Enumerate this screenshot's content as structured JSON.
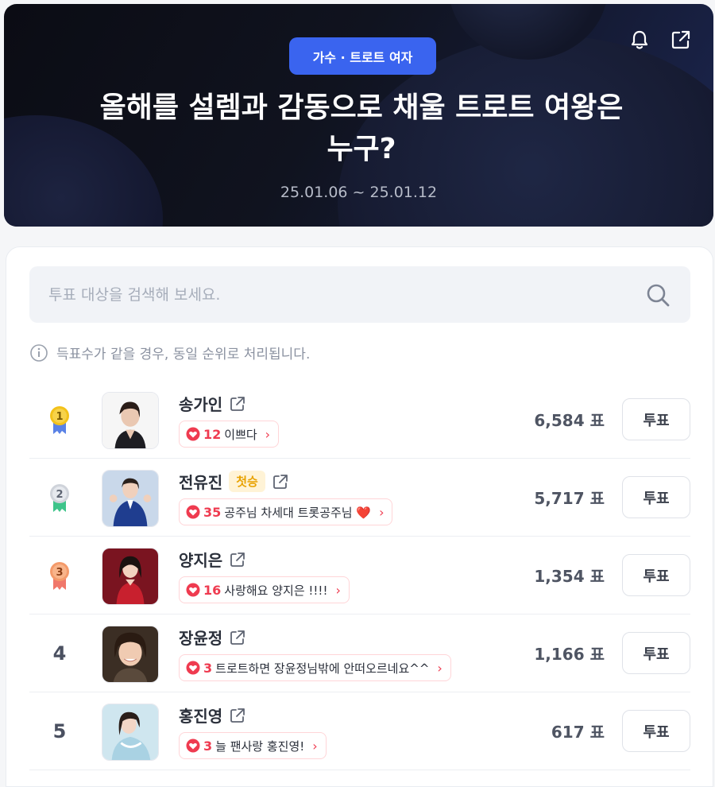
{
  "header": {
    "category": "가수 · 트로트 여자",
    "title_line1": "올해를 설렘과 감동으로 채울 트로트 여왕은",
    "title_line2": "누구?",
    "period": "25.01.06 ~ 25.01.12",
    "icons": [
      "bell-icon",
      "share-icon"
    ]
  },
  "search": {
    "placeholder": "투표 대상을 검색해 보세요.",
    "value": ""
  },
  "notice": "득표수가 같을 경우, 동일 순위로 처리됩니다.",
  "colors": {
    "accent": "#3a64ef",
    "heart": "#ef3b50",
    "gold": "#f3c21a",
    "silver": "#d5d8de",
    "bronze": "#f49a6a"
  },
  "candidates": [
    {
      "rank": "1",
      "medal": "gold",
      "name": "송가인",
      "badge": "",
      "cheer_count": "12",
      "cheer_text": "이쁘다",
      "votes": "6,584 표",
      "vote_label": "투표"
    },
    {
      "rank": "2",
      "medal": "silver",
      "name": "전유진",
      "badge": "첫승",
      "cheer_count": "35",
      "cheer_text": "공주님 차세대 트롯공주님 ❤️",
      "votes": "5,717 표",
      "vote_label": "투표"
    },
    {
      "rank": "3",
      "medal": "bronze",
      "name": "양지은",
      "badge": "",
      "cheer_count": "16",
      "cheer_text": "사랑해요 양지은 !!!!",
      "votes": "1,354 표",
      "vote_label": "투표"
    },
    {
      "rank": "4",
      "medal": "",
      "name": "장윤정",
      "badge": "",
      "cheer_count": "3",
      "cheer_text": "트로트하면 장윤정님밖에 안떠오르네요^^",
      "votes": "1,166 표",
      "vote_label": "투표"
    },
    {
      "rank": "5",
      "medal": "",
      "name": "홍진영",
      "badge": "",
      "cheer_count": "3",
      "cheer_text": "늘 팬사랑 홍진영!",
      "votes": "617 표",
      "vote_label": "투표"
    }
  ]
}
